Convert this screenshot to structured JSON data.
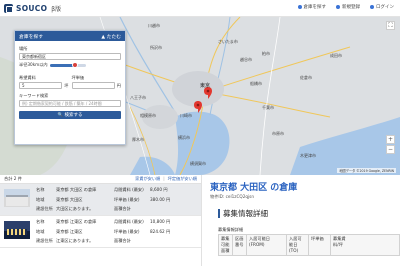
{
  "header": {
    "logo_text": "SOUCO",
    "logo_suffix": "β版",
    "nav": [
      {
        "label": "倉庫を探す",
        "icon": "search-icon"
      },
      {
        "label": "新規登録",
        "icon": "user-plus-icon"
      },
      {
        "label": "ログイン",
        "icon": "login-icon"
      }
    ]
  },
  "search_panel": {
    "title": "倉庫を探す",
    "collapse_label": "たたむ",
    "location_label": "場所",
    "location_value": "東京都新宿区",
    "radius_label": "半径30km以内",
    "radius_fraction": 0.7,
    "rent_label": "希望賃料",
    "rent_value": "5",
    "rent_unit": "坪",
    "rent2_label": "坪単価",
    "rent2_unit": "円",
    "keyword_label": "キーワード検索",
    "keyword_placeholder": "例) 定期借家契約可能 / 鉄筋 / 築年 / 24時間",
    "search_button": "検索する"
  },
  "map": {
    "zoom_in": "+",
    "zoom_out": "−",
    "credit": "地図データ ©2019 Google, ZENRIN",
    "labels": [
      "さいたま市",
      "所沢市",
      "川越市",
      "八王子市",
      "相模原市",
      "横浜市",
      "千葉市",
      "市原市",
      "東京",
      "川崎市",
      "船橋市",
      "木更津市",
      "横須賀市",
      "成田市",
      "柏市",
      "厚木市",
      "越谷市",
      "佐倉市"
    ]
  },
  "results": {
    "count_label": "合計 2 件",
    "sort1": "家賃が安い順",
    "sort2": "坪定価が安い順",
    "items": [
      {
        "name_label": "名称",
        "name": "東京都 大田区 の倉庫",
        "area_label": "地域",
        "area": "東京都 大田区",
        "addr_label": "建設住所",
        "addr": "大田区にあります。",
        "fee1_label": "月間賃料 (最安)",
        "fee1": "8,600 円",
        "fee2_label": "坪単価 (最安)",
        "fee2": "380.00 円",
        "fee3_label": "面積合計",
        "fee3": ""
      },
      {
        "name_label": "名称",
        "name": "東京都 江東区 の倉庫",
        "area_label": "地域",
        "area": "東京都 江東区",
        "addr_label": "建設住所",
        "addr": "江東区にあります。",
        "fee1_label": "月間賃料 (最安)",
        "fee1": "10,800 円",
        "fee2_label": "坪単価 (最安)",
        "fee2": "824.62 円",
        "fee3_label": "面積合計",
        "fee3": ""
      }
    ]
  },
  "detail": {
    "title": "東京都 大田区 の倉庫",
    "id_line": "物件ID: cel1zCQ2qjsn",
    "section_title": "募集情報詳細",
    "sub_title": "募集情報詳細",
    "table_headers": [
      "募集\n可能\n面積",
      "区画\n番号",
      "入居可能日\n(FROM)",
      "入居可\n能日\n(TO)",
      "坪単価",
      "募集賃\n料/坪"
    ]
  }
}
